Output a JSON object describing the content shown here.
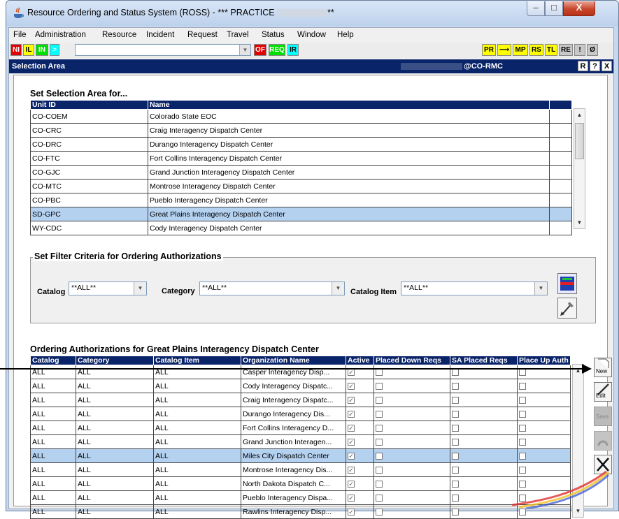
{
  "window": {
    "title": "Resource Ordering and Status System (ROSS) - *** PRACTICE ",
    "title_suffix": "**",
    "controls": {
      "minimize": "–",
      "maximize": "□",
      "close": "X"
    }
  },
  "menu": [
    "File",
    "Administration",
    "Resource",
    "Incident",
    "Request",
    "Travel",
    "Status",
    "Window",
    "Help"
  ],
  "toolbar": {
    "left_buttons": [
      {
        "label": "NI",
        "bg": "#e00000",
        "fg": "#ffffff"
      },
      {
        "label": "IL",
        "bg": "#ffff00",
        "fg": "#000000"
      },
      {
        "label": "IN",
        "bg": "#00dd00",
        "fg": "#ffffff"
      },
      {
        "label": ">",
        "bg": "#00ffff",
        "fg": "#ffffff"
      }
    ],
    "mid_buttons": [
      {
        "label": "OF",
        "bg": "#e00000",
        "fg": "#ffffff"
      },
      {
        "label": "REQ",
        "bg": "#00dd00",
        "fg": "#ffffff"
      },
      {
        "label": "IR",
        "bg": "#00ffff",
        "fg": "#000000"
      }
    ],
    "right_buttons": [
      {
        "label": "PR",
        "bg": "#ffff00",
        "fg": "#000000"
      },
      {
        "label": "⟶",
        "bg": "#ffff00",
        "fg": "#000000"
      },
      {
        "label": "MP",
        "bg": "#ffff00",
        "fg": "#000000"
      },
      {
        "label": "RS",
        "bg": "#ffff00",
        "fg": "#000000"
      },
      {
        "label": "TL",
        "bg": "#ffff00",
        "fg": "#000000"
      },
      {
        "label": "RE",
        "bg": "#c8c8c8",
        "fg": "#000000"
      },
      {
        "label": "!",
        "bg": "#c8c8c8",
        "fg": "#000000"
      },
      {
        "label": "Ø",
        "bg": "#c8c8c8",
        "fg": "#000000"
      }
    ]
  },
  "selection_bar": {
    "title": "Selection Area",
    "user": "@CO-RMC",
    "buttons": [
      "R",
      "?",
      "X"
    ]
  },
  "selection_area": {
    "heading": "Set Selection Area for...",
    "columns": [
      "Unit ID",
      "Name"
    ],
    "rows": [
      [
        "CO-COEM",
        "Colorado State EOC"
      ],
      [
        "CO-CRC",
        "Craig Interagency Dispatch Center"
      ],
      [
        "CO-DRC",
        "Durango Interagency Dispatch Center"
      ],
      [
        "CO-FTC",
        "Fort Collins Interagency Dispatch Center"
      ],
      [
        "CO-GJC",
        "Grand Junction Interagency Dispatch Center"
      ],
      [
        "CO-MTC",
        "Montrose Interagency Dispatch Center"
      ],
      [
        "CO-PBC",
        "Pueblo Interagency Dispatch Center"
      ],
      [
        "SD-GPC",
        "Great Plains Interagency Dispatch Center"
      ],
      [
        "WY-CDC",
        "Cody Interagency Dispatch Center"
      ]
    ],
    "selected_index": 7
  },
  "filter": {
    "legend": "Set Filter Criteria for Ordering Authorizations",
    "catalog_label": "Catalog",
    "catalog_value": "**ALL**",
    "category_label": "Category",
    "category_value": "**ALL**",
    "item_label": "Catalog Item",
    "item_value": "**ALL**"
  },
  "auth": {
    "heading": "Ordering Authorizations for Great Plains Interagency Dispatch Center",
    "columns": [
      "Catalog",
      "Category",
      "Catalog Item",
      "Organization Name",
      "Active",
      "Placed Down Reqs",
      "SA Placed Reqs",
      "Place Up Auth"
    ],
    "rows": [
      [
        "ALL",
        "ALL",
        "ALL",
        "Casper Interagency Disp..."
      ],
      [
        "ALL",
        "ALL",
        "ALL",
        "Cody Interagency Dispatc..."
      ],
      [
        "ALL",
        "ALL",
        "ALL",
        "Craig Interagency Dispatc..."
      ],
      [
        "ALL",
        "ALL",
        "ALL",
        "Durango Interagency Dis..."
      ],
      [
        "ALL",
        "ALL",
        "ALL",
        "Fort Collins Interagency D..."
      ],
      [
        "ALL",
        "ALL",
        "ALL",
        "Grand Junction Interagen..."
      ],
      [
        "ALL",
        "ALL",
        "ALL",
        "Miles City Dispatch Center"
      ],
      [
        "ALL",
        "ALL",
        "ALL",
        "Montrose Interagency Dis..."
      ],
      [
        "ALL",
        "ALL",
        "ALL",
        "North Dakota Dispatch C..."
      ],
      [
        "ALL",
        "ALL",
        "ALL",
        "Pueblo Interagency Dispa..."
      ],
      [
        "ALL",
        "ALL",
        "ALL",
        "Rawlins Interagency Disp..."
      ]
    ],
    "selected_index": 6,
    "side_buttons": {
      "new": "New",
      "edit": "Edit",
      "save": "Save"
    }
  }
}
